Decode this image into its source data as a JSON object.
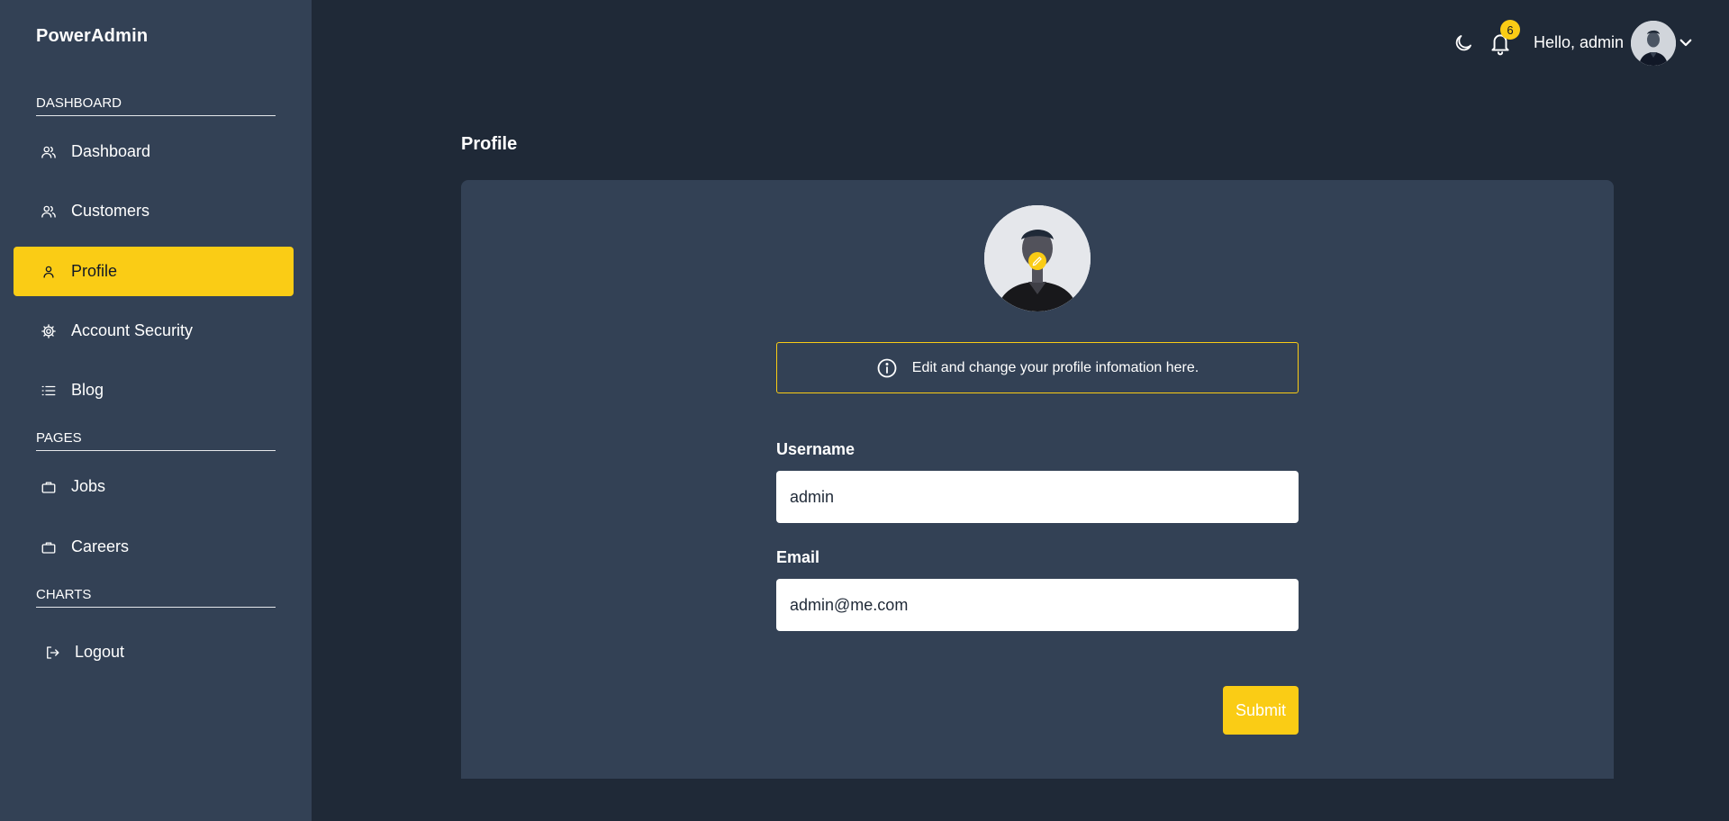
{
  "brand": "PowerAdmin",
  "sidebar": {
    "sections": [
      {
        "label": "DASHBOARD"
      },
      {
        "label": "PAGES"
      },
      {
        "label": "CHARTS"
      }
    ],
    "items": [
      {
        "label": "Dashboard",
        "icon": "users-icon"
      },
      {
        "label": "Customers",
        "icon": "users-icon"
      },
      {
        "label": "Profile",
        "icon": "user-icon",
        "active": true
      },
      {
        "label": "Account Security",
        "icon": "gear-icon"
      },
      {
        "label": "Blog",
        "icon": "list-icon"
      },
      {
        "label": "Jobs",
        "icon": "briefcase-icon"
      },
      {
        "label": "Careers",
        "icon": "briefcase-icon"
      },
      {
        "label": "Logout",
        "icon": "logout-icon"
      }
    ]
  },
  "topbar": {
    "theme_icon": "moon-icon",
    "notifications_icon": "bell-icon",
    "notification_count": "6",
    "greeting": "Hello, admin",
    "avatar_icon": "avatar",
    "menu_icon": "chevron-down-icon"
  },
  "page": {
    "title": "Profile",
    "info_text": "Edit and change your profile infomation here.",
    "username_label": "Username",
    "username_value": "admin",
    "email_label": "Email",
    "email_value": "admin@me.com",
    "submit_label": "Submit"
  },
  "colors": {
    "accent": "#facc15",
    "sidebar_bg": "#334155",
    "page_bg": "#1f2937",
    "card_bg": "#334155"
  }
}
